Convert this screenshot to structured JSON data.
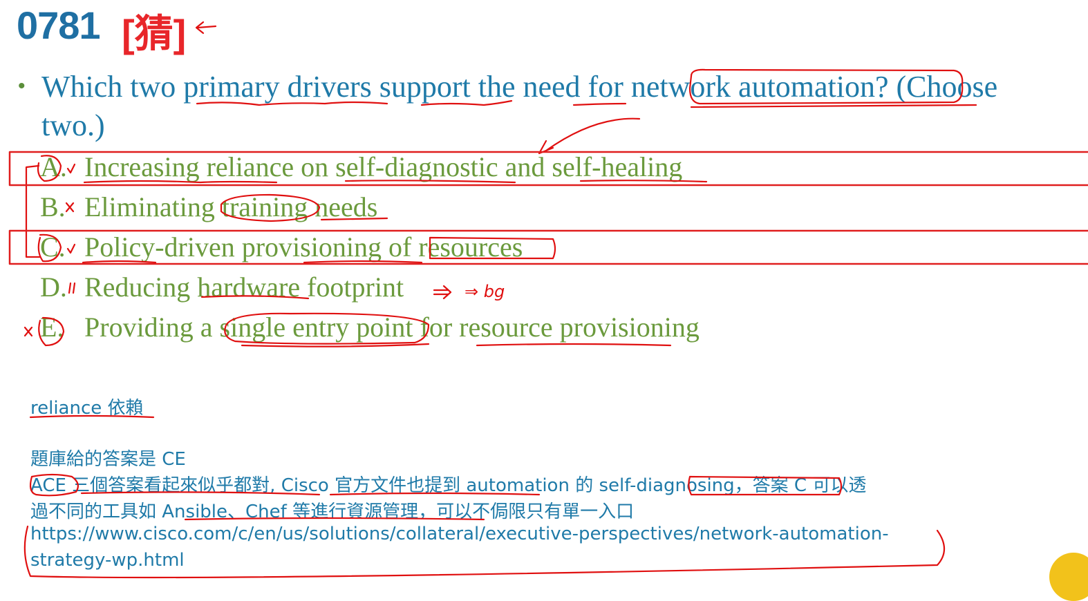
{
  "header": {
    "number": "0781",
    "tag": "[猜]"
  },
  "question": {
    "bullet": "•",
    "text": "Which two primary drivers support the need for network automation? (Choose two.)"
  },
  "options": [
    {
      "letter": "A.",
      "text": "Increasing reliance on self-diagnostic and self-healing"
    },
    {
      "letter": "B.",
      "text": "Eliminating training needs"
    },
    {
      "letter": "C.",
      "text": "Policy-driven provisioning of resources"
    },
    {
      "letter": "D.",
      "text": "Reducing hardware footprint"
    },
    {
      "letter": "E.",
      "text": "Providing a single entry point for resource provisioning"
    }
  ],
  "annotations": {
    "d_note": "⇒ bg"
  },
  "notes": {
    "vocab": "reliance 依賴",
    "answer_line": "題庫給的答案是 CE",
    "line2": "ACE 三個答案看起來似乎都對, Cisco 官方文件也提到 automation 的 self-diagnosing，答案 C 可以透",
    "line3": "過不同的工具如 Ansible、Chef 等進行資源管理，可以不侷限只有單一入口",
    "url_line1": "https://www.cisco.com/c/en/us/solutions/collateral/executive-perspectives/network-automation-",
    "url_line2": "strategy-wp.html"
  },
  "colors": {
    "title_blue": "#1f6fa3",
    "tag_red": "#e8262a",
    "question_blue": "#1f7aa8",
    "option_green": "#6b9a3d",
    "ink_red": "#e01010",
    "box_red": "#e01e1e"
  }
}
